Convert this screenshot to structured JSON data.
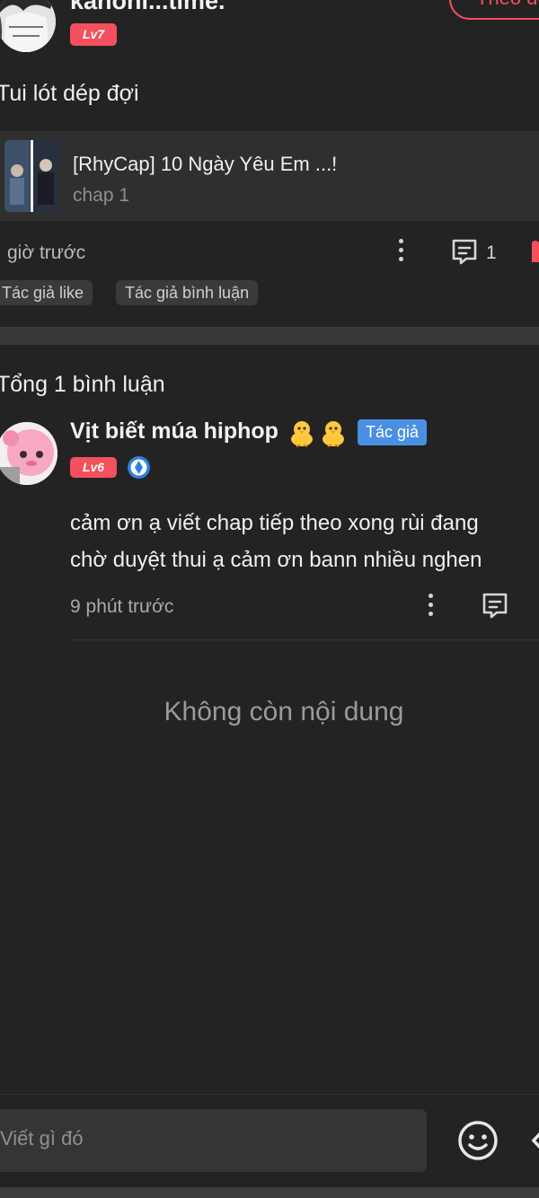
{
  "post": {
    "username": "kanoni...time.",
    "level": "Lv7",
    "follow_label": "Theo dõi",
    "text": "Tui lót dép đợi",
    "chapter": {
      "title": "[RhyCap] 10 Ngày Yêu Em ...!",
      "subtitle": "chap 1"
    },
    "time": "giờ trước",
    "comment_count": "1",
    "tags": [
      "Tác giả like",
      "Tác giả bình luận"
    ]
  },
  "comments_section": {
    "total_label": "Tổng 1 bình luận",
    "comments": [
      {
        "name": "Vịt biết múa hiphop",
        "name_emoji": "🐥🐥",
        "author_badge": "Tác giả",
        "level": "Lv6",
        "body_lines": [
          "cảm ơn ạ viết chap tiếp theo xong rùi đang",
          "chờ duyệt thui ạ cảm ơn bann nhiều nghen"
        ],
        "time": "9 phút trước"
      }
    ],
    "end_label": "Không còn nội dung"
  },
  "composer": {
    "placeholder": "Viết gì đó"
  },
  "colors": {
    "background": "#232323",
    "accent": "#f4505e",
    "author_badge": "#4a90e2"
  },
  "icons": [
    "more-vertical-icon",
    "comment-icon",
    "like-icon",
    "emoji-icon",
    "send-icon",
    "vip-diamond-icon"
  ]
}
